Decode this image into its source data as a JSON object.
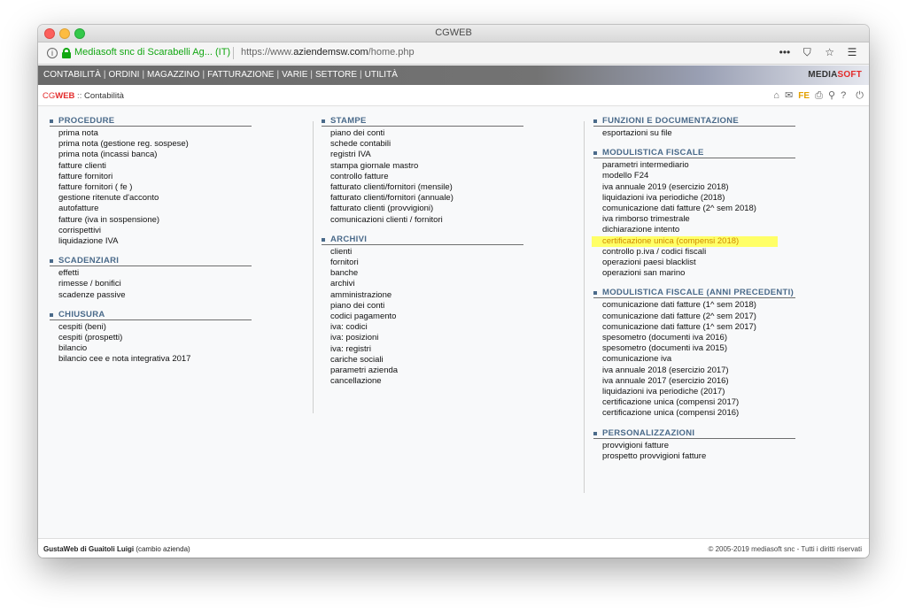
{
  "window": {
    "title": "CGWEB"
  },
  "browser": {
    "site_identity": "Mediasoft snc di Scarabelli Ag... (IT)",
    "url_prefix": "https://www.",
    "url_domain": "aziendemsw.com",
    "url_path": "/home.php",
    "icons": [
      "more-icon",
      "pocket-icon",
      "bookmark-star-icon",
      "hamburger-menu-icon"
    ]
  },
  "menu": {
    "items": [
      "CONTABILITÀ",
      "ORDINI",
      "MAGAZZINO",
      "FATTURAZIONE",
      "VARIE",
      "SETTORE",
      "UTILITÀ"
    ],
    "brand_main": "MEDIA",
    "brand_accent": "SOFT"
  },
  "breadcrumb": {
    "cg": "CG",
    "web": "WEB",
    "sep": " :: ",
    "page": "Contabilità"
  },
  "toolbar": {
    "fe_label": "FE"
  },
  "columns": [
    {
      "sections": [
        {
          "title": "PROCEDURE",
          "items": [
            "prima nota",
            "prima nota (gestione reg. sospese)",
            "prima nota (incassi banca)",
            "fatture clienti",
            "fatture fornitori",
            "fatture fornitori ( fe )",
            "gestione ritenute d'acconto",
            "autofatture",
            "fatture (iva in sospensione)",
            "corrispettivi",
            "liquidazione IVA"
          ]
        },
        {
          "title": "SCADENZIARI",
          "items": [
            "effetti",
            "rimesse / bonifici",
            "scadenze passive"
          ]
        },
        {
          "title": "CHIUSURA",
          "items": [
            "cespiti (beni)",
            "cespiti (prospetti)",
            "bilancio",
            "bilancio cee e nota integrativa 2017"
          ]
        }
      ]
    },
    {
      "sections": [
        {
          "title": "STAMPE",
          "items": [
            "piano dei conti",
            "schede contabili",
            "registri IVA",
            "stampa giornale mastro",
            "controllo fatture",
            "fatturato clienti/fornitori (mensile)",
            "fatturato clienti/fornitori (annuale)",
            "fatturato clienti (provvigioni)",
            "comunicazioni clienti / fornitori"
          ]
        },
        {
          "title": "ARCHIVI",
          "items": [
            "clienti",
            "fornitori",
            "banche",
            "archivi",
            "amministrazione",
            "piano dei conti",
            "codici pagamento",
            "iva: codici",
            "iva: posizioni",
            "iva: registri",
            "cariche sociali",
            "parametri azienda",
            "cancellazione"
          ]
        }
      ]
    },
    {
      "sections": [
        {
          "title": "FUNZIONI E DOCUMENTAZIONE",
          "items": [
            "esportazioni su file"
          ]
        },
        {
          "title": "MODULISTICA FISCALE",
          "items": [
            "parametri intermediario",
            "modello F24",
            "iva annuale 2019 (esercizio 2018)",
            "liquidazioni iva periodiche (2018)",
            "comunicazione dati fatture (2^ sem 2018)",
            "iva rimborso trimestrale",
            "dichiarazione intento",
            "certificazione unica (compensi 2018)",
            "controllo p.iva / codici fiscali",
            "operazioni paesi blacklist",
            "operazioni san marino"
          ]
        },
        {
          "title": "MODULISTICA FISCALE (ANNI PRECEDENTI)",
          "items": [
            "comunicazione dati fatture (1^ sem 2018)",
            "comunicazione dati fatture (2^ sem 2017)",
            "comunicazione dati fatture (1^ sem 2017)",
            "spesometro (documenti iva 2016)",
            "spesometro (documenti iva 2015)",
            "comunicazione iva",
            "iva annuale 2018 (esercizio 2017)",
            "iva annuale 2017 (esercizio 2016)",
            "liquidazioni iva periodiche (2017)",
            "certificazione unica (compensi 2017)",
            "certificazione unica (compensi 2016)"
          ]
        },
        {
          "title": "PERSONALIZZAZIONI",
          "items": [
            "provvigioni fatture",
            "prospetto provvigioni fatture"
          ]
        }
      ]
    }
  ],
  "highlighted_item": "certificazione unica (compensi 2018)",
  "footer": {
    "user_bold": "GustaWeb di Guaitoli Luigi",
    "user_link": "(cambio azienda)",
    "copyright": "© 2005-2019 mediasoft snc - Tutti i diritti riservati"
  }
}
